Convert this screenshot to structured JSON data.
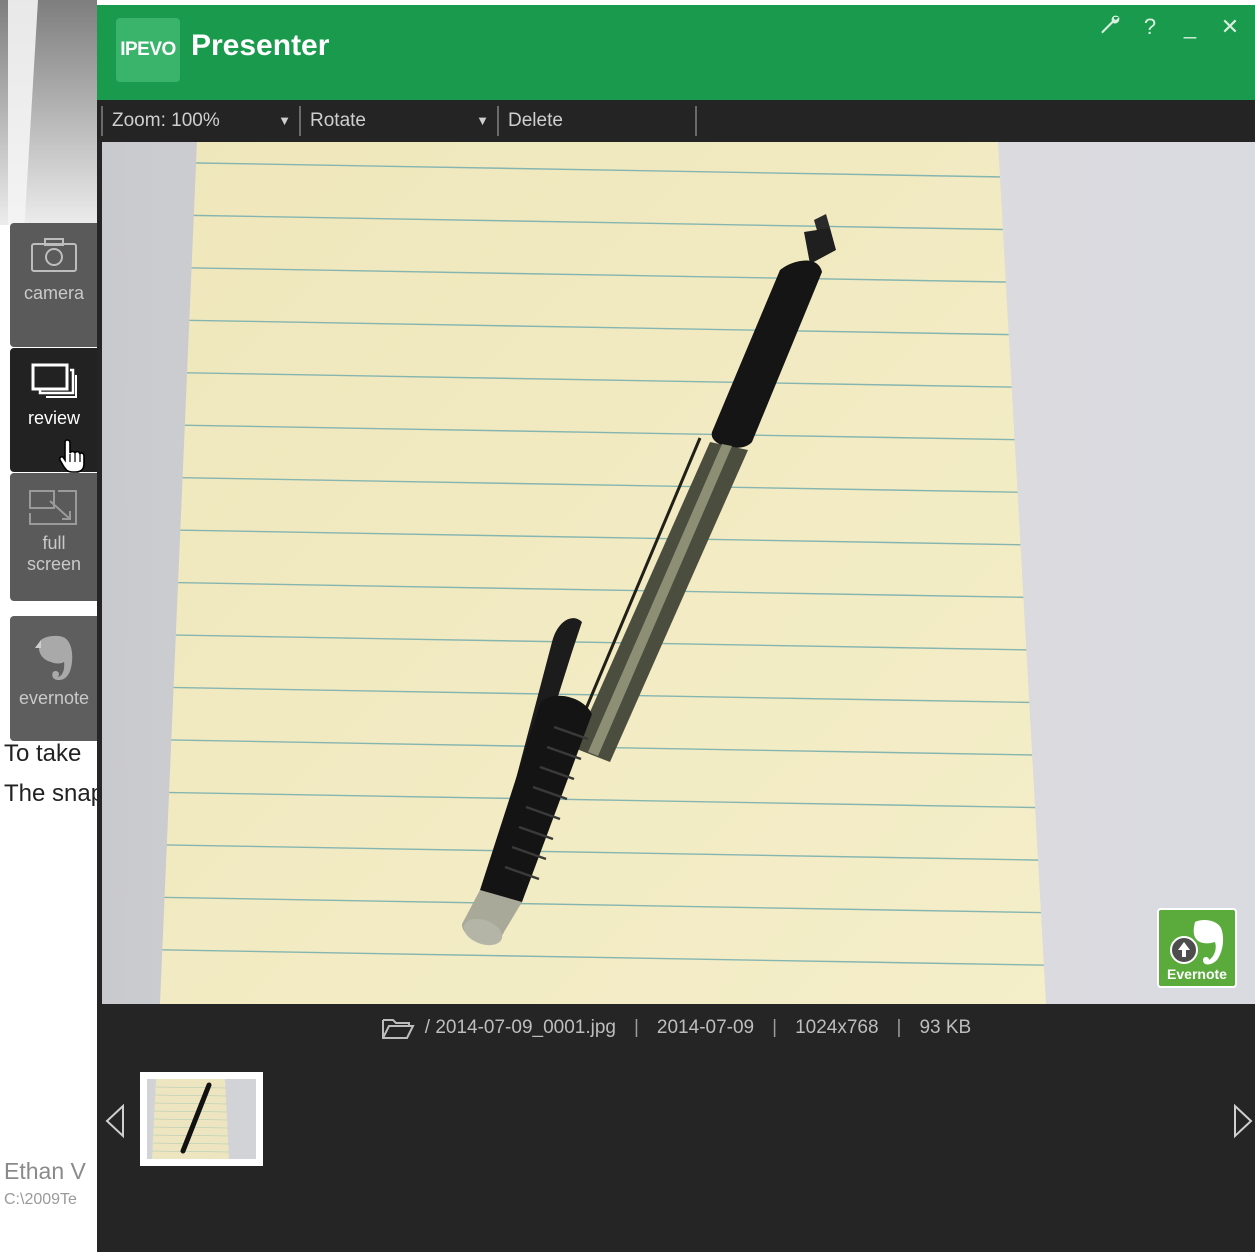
{
  "background_document": {
    "line1": "To take",
    "line2": "The snap",
    "line3": "Ethan V",
    "line4": "C:\\2009Te"
  },
  "sidebar": {
    "items": [
      {
        "label": "camera",
        "icon": "camera-icon",
        "active": false
      },
      {
        "label": "review",
        "icon": "review-icon",
        "active": true
      },
      {
        "label_line1": "full",
        "label_line2": "screen",
        "icon": "fullscreen-icon",
        "active": false
      },
      {
        "label": "evernote",
        "icon": "evernote-icon",
        "active": false
      }
    ]
  },
  "window": {
    "logo_text": "IPEVO",
    "title": "Presenter",
    "controls": {
      "settings": "settings-wrench-icon",
      "help": "?",
      "minimize": "_",
      "close": "✕"
    }
  },
  "toolbar": {
    "zoom_label": "Zoom: 100%",
    "rotate_label": "Rotate",
    "delete_label": "Delete",
    "dropdown_arrow": "▼"
  },
  "viewer": {
    "evernote_badge_label": "Evernote"
  },
  "file_info": {
    "path": "/ 2014-07-09_0001.jpg",
    "date": "2014-07-09",
    "resolution": "1024x768",
    "size": "93 KB",
    "separator": "|"
  },
  "colors": {
    "titlebar": "#1a9a4c",
    "logo_box": "#39b46a",
    "app_body": "#252525",
    "sidebar_button": "#5a5a5a",
    "sidebar_active": "#222222",
    "paper": "#f2ebc2",
    "rule_line": "#7fb3b5",
    "evernote_green": "#5aaa3c"
  }
}
